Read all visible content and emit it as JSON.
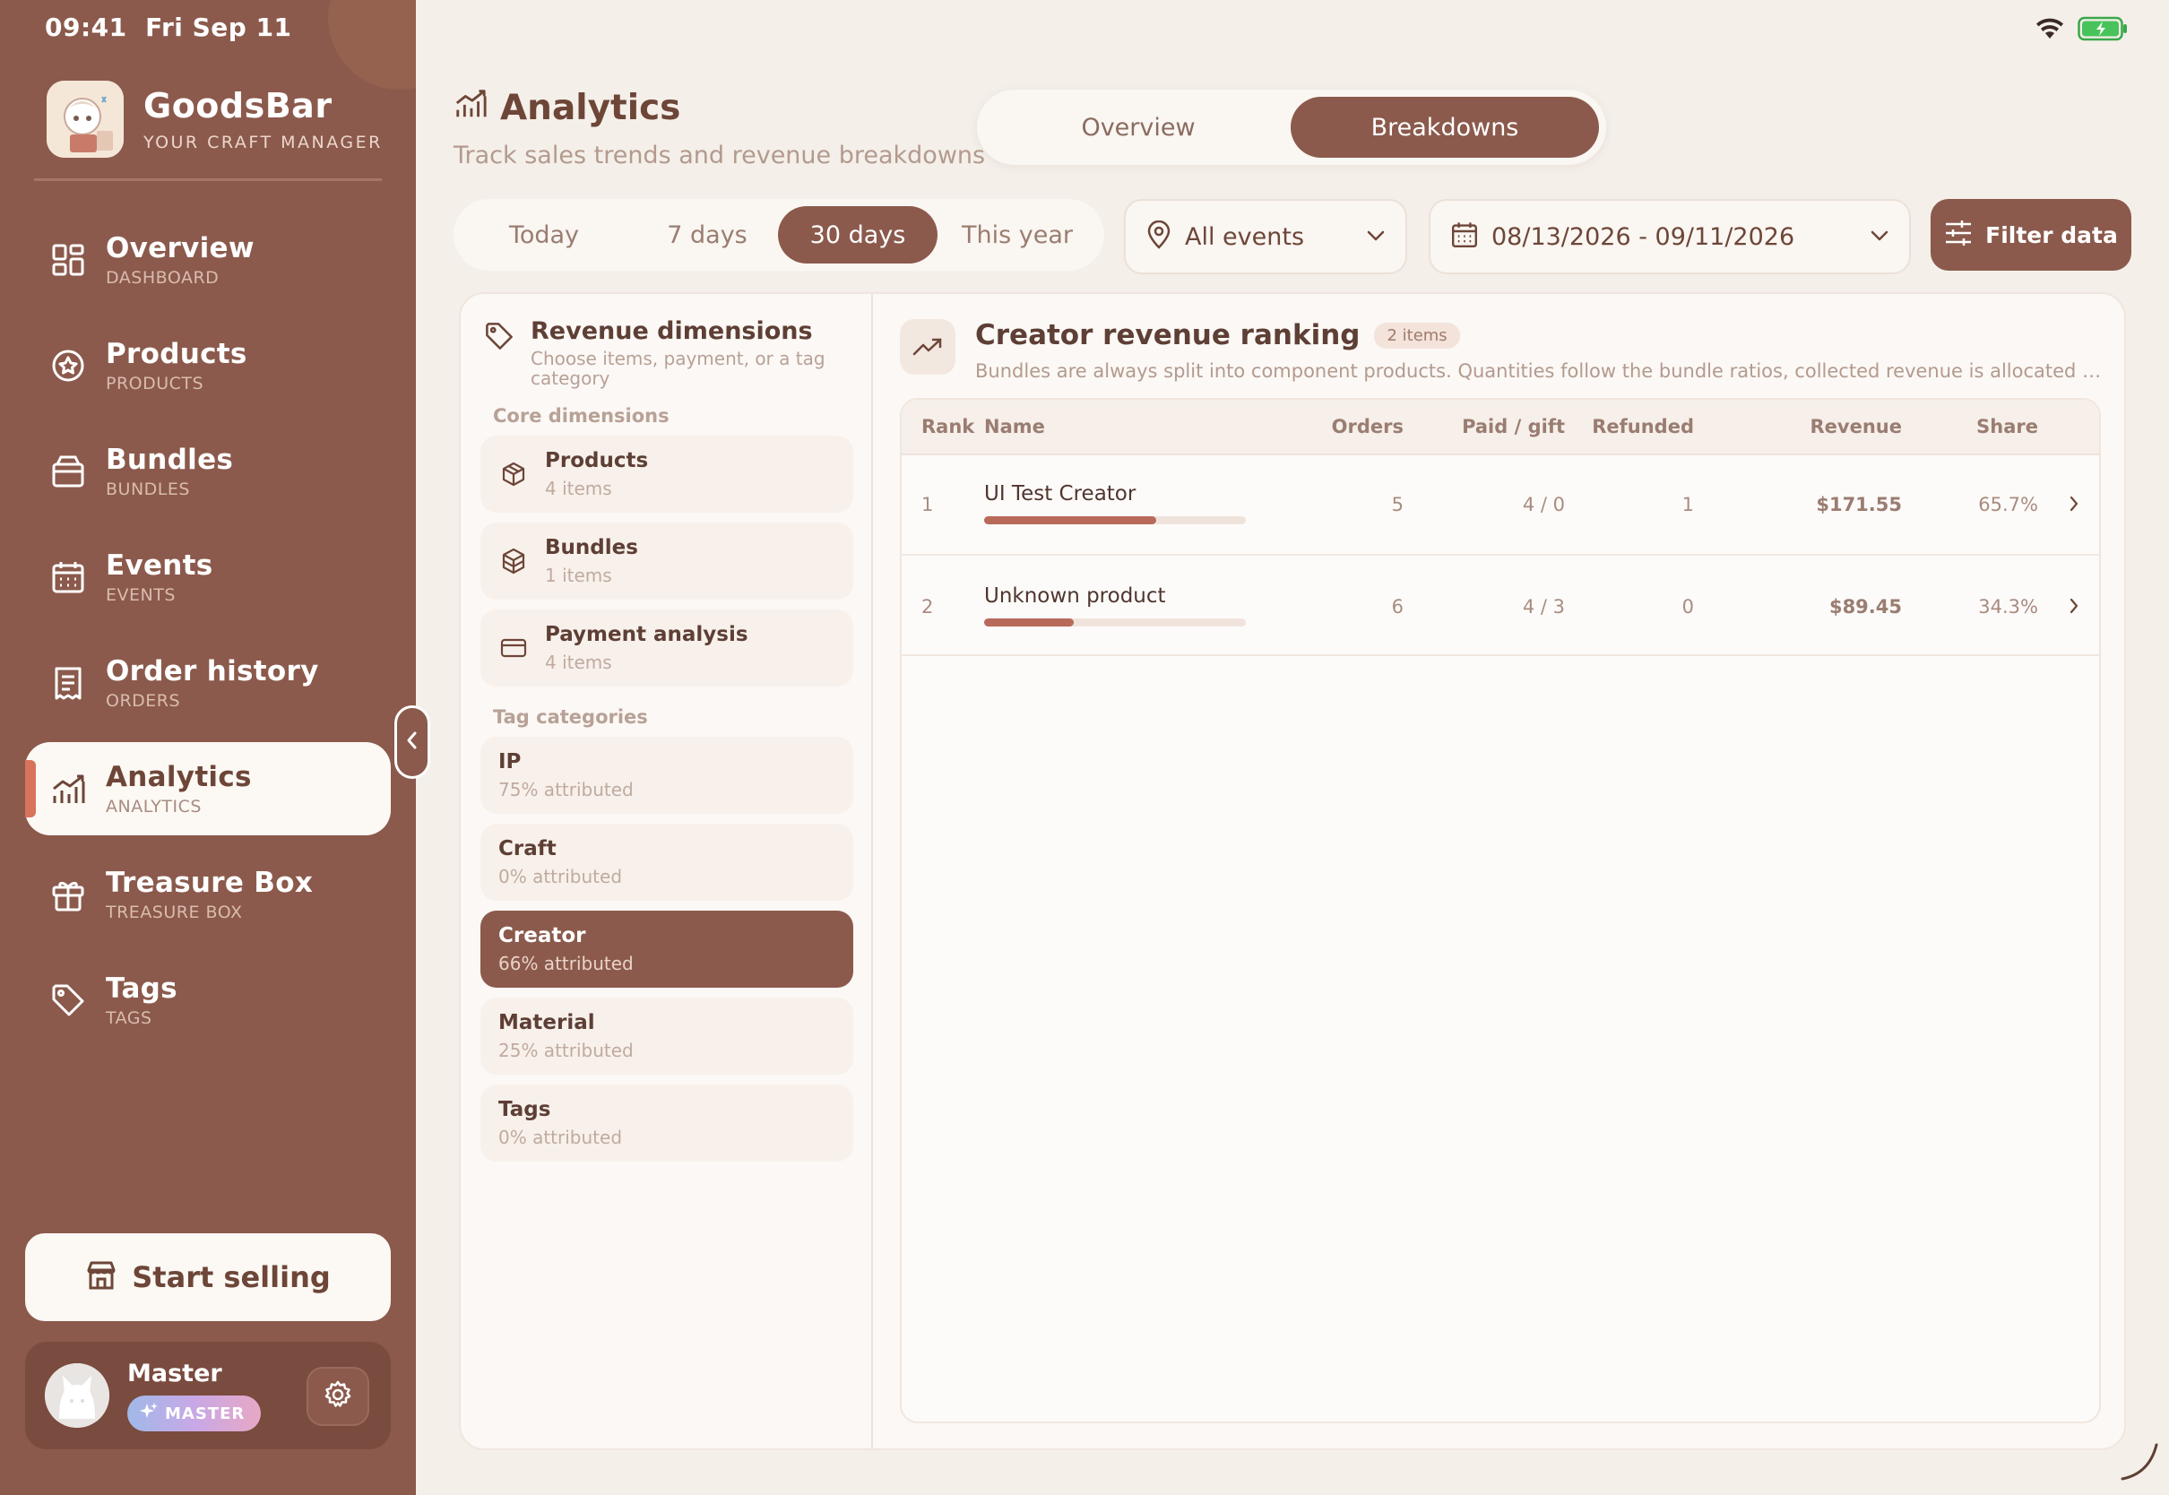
{
  "status": {
    "time": "09:41",
    "date": "Fri Sep 11"
  },
  "brand": {
    "name": "GoodsBar",
    "subtitle": "YOUR CRAFT MANAGER"
  },
  "nav": [
    {
      "label": "Overview",
      "sub": "DASHBOARD",
      "icon": "grid-icon"
    },
    {
      "label": "Products",
      "sub": "PRODUCTS",
      "icon": "badge-icon"
    },
    {
      "label": "Bundles",
      "sub": "BUNDLES",
      "icon": "box-icon"
    },
    {
      "label": "Events",
      "sub": "EVENTS",
      "icon": "calendar-icon"
    },
    {
      "label": "Order history",
      "sub": "ORDERS",
      "icon": "receipt-icon"
    },
    {
      "label": "Analytics",
      "sub": "ANALYTICS",
      "icon": "chart-icon",
      "active": true
    },
    {
      "label": "Treasure Box",
      "sub": "TREASURE BOX",
      "icon": "gift-icon"
    },
    {
      "label": "Tags",
      "sub": "TAGS",
      "icon": "tag-icon"
    }
  ],
  "start_selling": "Start selling",
  "user": {
    "name": "Master",
    "badge": "MASTER"
  },
  "page": {
    "title": "Analytics",
    "subtitle": "Track sales trends and revenue breakdowns"
  },
  "view_tabs": {
    "overview": "Overview",
    "breakdowns": "Breakdowns",
    "active": "Breakdowns"
  },
  "ranges": {
    "today": "Today",
    "d7": "7 days",
    "d30": "30 days",
    "year": "This year",
    "active": "30 days"
  },
  "event_select": {
    "value": "All events"
  },
  "date_range": {
    "value": "08/13/2026 - 09/11/2026"
  },
  "filter_button": "Filter data",
  "dimensions": {
    "title": "Revenue dimensions",
    "subtitle": "Choose items, payment, or a tag category",
    "core_label": "Core dimensions",
    "core": [
      {
        "name": "Products",
        "meta": "4 items"
      },
      {
        "name": "Bundles",
        "meta": "1 items"
      },
      {
        "name": "Payment analysis",
        "meta": "4 items"
      }
    ],
    "tag_label": "Tag categories",
    "tags": [
      {
        "name": "IP",
        "meta": "75% attributed"
      },
      {
        "name": "Craft",
        "meta": "0% attributed"
      },
      {
        "name": "Creator",
        "meta": "66% attributed",
        "active": true
      },
      {
        "name": "Material",
        "meta": "25% attributed"
      },
      {
        "name": "Tags",
        "meta": "0% attributed"
      }
    ]
  },
  "ranking": {
    "title": "Creator revenue ranking",
    "badge": "2 items",
    "subtitle": "Bundles are always split into component products. Quantities follow the bundle ratios, collected revenue is allocated by c…",
    "columns": {
      "rank": "Rank",
      "name": "Name",
      "orders": "Orders",
      "paid_gift": "Paid / gift",
      "refunded": "Refunded",
      "revenue": "Revenue",
      "share": "Share"
    },
    "rows": [
      {
        "rank": "1",
        "name": "UI Test Creator",
        "orders": "5",
        "paid_gift": "4 / 0",
        "refunded": "1",
        "revenue": "$171.55",
        "share": "65.7%",
        "share_fraction": 0.657
      },
      {
        "rank": "2",
        "name": "Unknown product",
        "orders": "6",
        "paid_gift": "4 / 3",
        "refunded": "0",
        "revenue": "$89.45",
        "share": "34.3%",
        "share_fraction": 0.343
      }
    ]
  },
  "colors": {
    "sidebar": "#8b5a4c",
    "accent": "#b86a5a",
    "active_marker": "#d8735c",
    "background": "#f4efe9"
  }
}
